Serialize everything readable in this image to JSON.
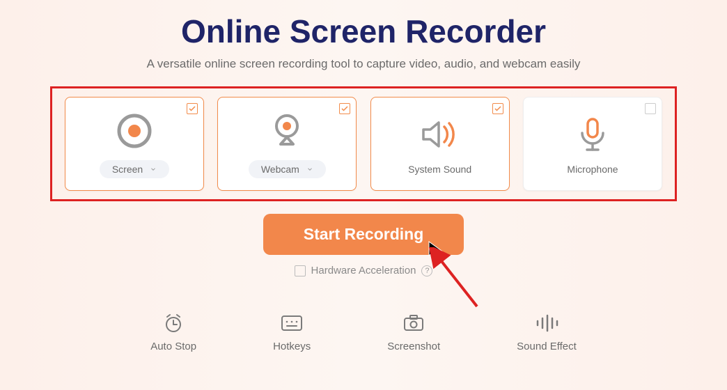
{
  "header": {
    "title": "Online Screen Recorder",
    "subtitle": "A versatile online screen recording tool to capture video, audio, and webcam easily"
  },
  "sources": {
    "screen": {
      "label": "Screen",
      "checked": true,
      "hasDropdown": true
    },
    "webcam": {
      "label": "Webcam",
      "checked": true,
      "hasDropdown": true
    },
    "system": {
      "label": "System Sound",
      "checked": true,
      "hasDropdown": false
    },
    "mic": {
      "label": "Microphone",
      "checked": false,
      "hasDropdown": false
    }
  },
  "actions": {
    "start_label": "Start Recording",
    "hw_accel_label": "Hardware Acceleration"
  },
  "tools": {
    "autostop": "Auto Stop",
    "hotkeys": "Hotkeys",
    "screenshot": "Screenshot",
    "soundeffect": "Sound Effect"
  }
}
